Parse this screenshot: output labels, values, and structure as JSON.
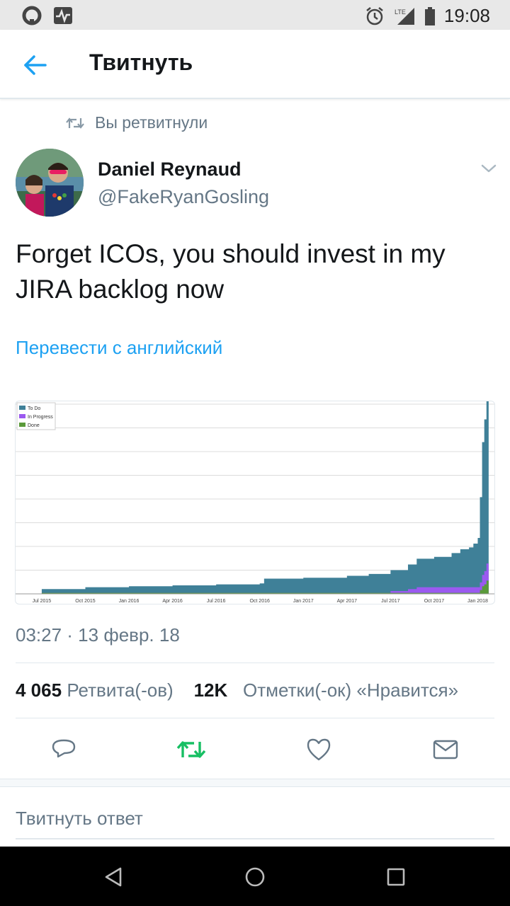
{
  "status_bar": {
    "time": "19:08",
    "network": "LTE"
  },
  "header": {
    "title": "Твитнуть",
    "back_icon": "arrow-left-icon"
  },
  "retweet_context": {
    "text": "Вы ретвитнули"
  },
  "tweet": {
    "author_name": "Daniel Reynaud",
    "author_handle": "@FakeRyanGosling",
    "text": "Forget ICOs, you should invest in my JIRA backlog now",
    "translate_label": "Перевести с английский",
    "timestamp": "03:27 · 13 февр. 18"
  },
  "stats": {
    "retweets_count": "4 065",
    "retweets_label": "Ретвита(-ов)",
    "likes_count": "12K",
    "likes_label": "Отметки(-ок) «Нравится»"
  },
  "actions": {
    "reply_icon": "reply-icon",
    "retweet_icon": "retweet-icon",
    "like_icon": "heart-icon",
    "dm_icon": "mail-icon"
  },
  "reply_placeholder": "Твитнуть ответ",
  "colors": {
    "accent": "#1da1f2",
    "retweet_active": "#17bf63",
    "secondary_text": "#657786",
    "todo": "#3f8098",
    "in_progress": "#9b59f0",
    "done": "#5a9a3a"
  },
  "chart_data": {
    "type": "area",
    "stacked": true,
    "legend_position": "top-left",
    "grid": true,
    "x_ticks": [
      "Jul 2015",
      "Oct 2015",
      "Jan 2016",
      "Apr 2016",
      "Jul 2016",
      "Oct 2016",
      "Jan 2017",
      "Apr 2017",
      "Jul 2017",
      "Oct 2017",
      "Jan 2018"
    ],
    "x": [
      0,
      1,
      2,
      3,
      4,
      5,
      5.1,
      6,
      7,
      7.5,
      8,
      8.4,
      8.6,
      9,
      9.4,
      9.6,
      9.8,
      9.9,
      10,
      10.05,
      10.1,
      10.15,
      10.2,
      10.25
    ],
    "ylim": [
      0,
      100
    ],
    "series": [
      {
        "name": "To Do",
        "color": "#3f8098",
        "values": [
          2,
          3,
          3.5,
          4,
          4.5,
          5,
          7.5,
          8,
          9,
          10,
          11,
          13,
          15,
          16,
          18,
          20,
          21,
          23,
          26,
          45,
          70,
          80,
          90,
          95
        ]
      },
      {
        "name": "In Progress",
        "color": "#9b59f0",
        "values": [
          0,
          0,
          0,
          0,
          0,
          0,
          0,
          0,
          0,
          0,
          1,
          2,
          3,
          3,
          3,
          3,
          3,
          3,
          3,
          4,
          6,
          7,
          9,
          10
        ]
      },
      {
        "name": "Done",
        "color": "#5a9a3a",
        "values": [
          0.5,
          0.5,
          0.5,
          0.5,
          0.5,
          0.5,
          0.5,
          0.5,
          0.5,
          0.5,
          0.5,
          0.5,
          0.5,
          0.5,
          0.5,
          0.5,
          0.5,
          0.5,
          0.5,
          2,
          4,
          5,
          7,
          10
        ]
      }
    ]
  }
}
